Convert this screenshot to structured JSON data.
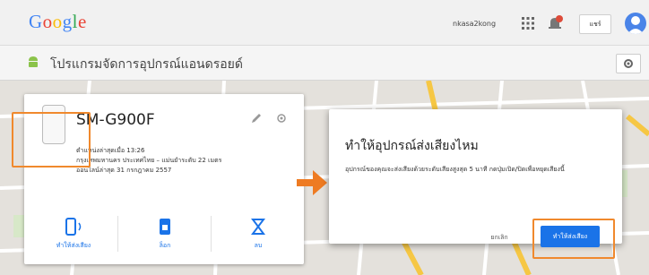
{
  "header": {
    "logo": [
      "G",
      "o",
      "o",
      "g",
      "l",
      "e"
    ],
    "logo_colors": [
      "#4285f4",
      "#ea4335",
      "#fbbc05",
      "#4285f4",
      "#34a853",
      "#ea4335"
    ],
    "user": "nkasa2kong",
    "share_label": "แชร์"
  },
  "subbar": {
    "title": "โปรแกรมจัดการอุปกรณ์แอนดรอยด์"
  },
  "device": {
    "name": "SM-G900F",
    "info_lines": [
      "ตำแหน่งล่าสุดเมื่อ 13:26",
      "กรุงเทพมหานคร ประเทศไทย – แม่นยำระดับ 22 เมตร",
      "ออนไลน์ล่าสุด 31 กรกฎาคม 2557"
    ],
    "actions": [
      {
        "label": "ทำให้ส่งเสียง",
        "icon": "ring-icon"
      },
      {
        "label": "ล็อก",
        "icon": "lock-icon"
      },
      {
        "label": "ลบ",
        "icon": "erase-icon"
      }
    ]
  },
  "dialog": {
    "title": "ทำให้อุปกรณ์ส่งเสียงไหม",
    "body": "อุปกรณ์ของคุณจะส่งเสียงด้วยระดับเสียงสูงสุด 5 นาที กดปุ่มเปิด/ปิดเพื่อหยุดเสียงนี้",
    "cancel_label": "ยกเลิก",
    "ok_label": "ทำให้ส่งเสียง"
  },
  "colors": {
    "accent": "#1a73e8",
    "highlight": "#f0892d",
    "arrow": "#ee7b22",
    "road": "#f6c744"
  }
}
